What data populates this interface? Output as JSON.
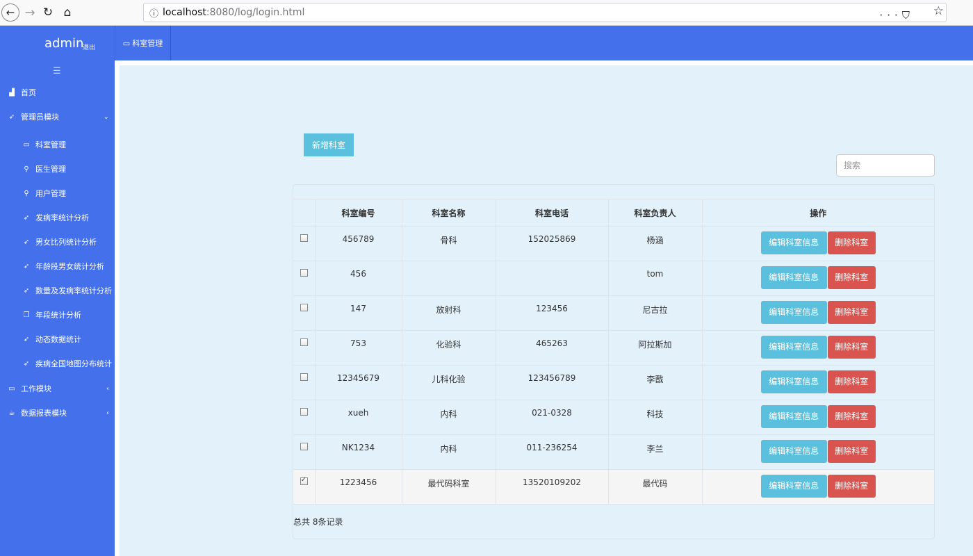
{
  "browser": {
    "url_host": "localhost",
    "url_rest": ":8080/log/login.html",
    "more_icon": "ellipsis-icon",
    "pocket_icon": "pocket-icon",
    "star_icon": "star-icon"
  },
  "header": {
    "brand": "admin",
    "logout": "退出",
    "tab_label": "科室管理"
  },
  "sidebar": {
    "items": [
      {
        "label": "首页",
        "icon": "chart-icon",
        "level": "top"
      },
      {
        "label": "管理员模块",
        "icon": "paper-plane-icon",
        "level": "top",
        "arrow": "⌄"
      },
      {
        "label": "科室管理",
        "icon": "monitor-icon",
        "level": "sub"
      },
      {
        "label": "医生管理",
        "icon": "search-icon",
        "level": "sub"
      },
      {
        "label": "用户管理",
        "icon": "search-icon",
        "level": "sub"
      },
      {
        "label": "发病率统计分析",
        "icon": "paper-plane-icon",
        "level": "sub"
      },
      {
        "label": "男女比列统计分析",
        "icon": "paper-plane-icon",
        "level": "sub"
      },
      {
        "label": "年龄段男女统计分析",
        "icon": "paper-plane-icon",
        "level": "sub"
      },
      {
        "label": "数量及发病率统计分析",
        "icon": "paper-plane-icon",
        "level": "sub"
      },
      {
        "label": "年段统计分析",
        "icon": "clone-icon",
        "level": "sub"
      },
      {
        "label": "动态数据统计",
        "icon": "paper-plane-icon",
        "level": "sub"
      },
      {
        "label": "疾病全国地图分布统计",
        "icon": "paper-plane-icon",
        "level": "sub"
      },
      {
        "label": "工作模块",
        "icon": "monitor-icon",
        "level": "top",
        "arrow": "‹"
      },
      {
        "label": "数据报表模块",
        "icon": "cup-icon",
        "level": "top",
        "arrow": "‹"
      }
    ]
  },
  "main": {
    "add_button": "新增科室",
    "search_placeholder": "搜索",
    "columns": [
      "科室编号",
      "科室名称",
      "科室电话",
      "科室负责人",
      "操作"
    ],
    "rows": [
      {
        "id": "456789",
        "name": "骨科",
        "phone": "152025869",
        "head": "杨涵",
        "checked": false
      },
      {
        "id": "456",
        "name": "",
        "phone": "",
        "head": "tom",
        "checked": false
      },
      {
        "id": "147",
        "name": "放射科",
        "phone": "123456",
        "head": "尼古拉",
        "checked": false
      },
      {
        "id": "753",
        "name": "化验科",
        "phone": "465263",
        "head": "阿拉斯加",
        "checked": false
      },
      {
        "id": "12345679",
        "name": "儿科化验",
        "phone": "123456789",
        "head": "李戬",
        "checked": false
      },
      {
        "id": "xueh",
        "name": "内科",
        "phone": "021-0328",
        "head": "科技",
        "checked": false
      },
      {
        "id": "NK1234",
        "name": "内科",
        "phone": "011-236254",
        "head": "李兰",
        "checked": false
      },
      {
        "id": "1223456",
        "name": "最代码科室",
        "phone": "13520109202",
        "head": "最代码",
        "checked": true
      }
    ],
    "edit_label": "编辑科室信息",
    "delete_label": "删除科室",
    "total_text": "总共 8条记录"
  }
}
